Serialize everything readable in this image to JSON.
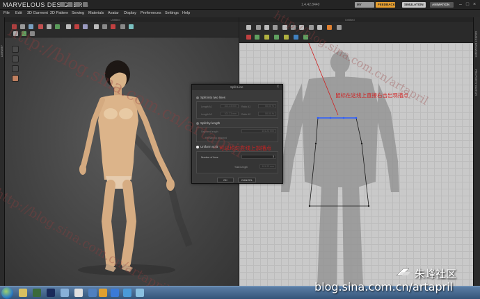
{
  "app": {
    "title": "MARVELOUS DESIGNER 4",
    "version": "1.4.42.8440",
    "buttons": {
      "account": "MY ACCOUNT",
      "feedback": "FEEDBACK",
      "simulation": "SIMULATION",
      "animation": "ANIMATION"
    },
    "window_controls": [
      "–",
      "□",
      "×"
    ]
  },
  "menu": [
    "File",
    "Edit",
    "3D Garment",
    "2D Pattern",
    "Sewing",
    "Materials",
    "Avatar",
    "Display",
    "Preferences",
    "Settings",
    "Help"
  ],
  "panels": {
    "left_strip_label": "LIBRARY",
    "view3d_title": "Untitled",
    "view2d_title": "Untitled",
    "right_strip_labels": [
      "OBJECT BROWSER",
      "PROPERTY EDITOR"
    ]
  },
  "dialog": {
    "title": "Split Line",
    "close": "x",
    "option_two_lines": "Split into two lines",
    "length1_label": "Length A1",
    "length1_value": "101.23 mm",
    "length2_label": "Length A2",
    "length2_value": "101.23 mm",
    "ratio1_label": "Ratio A1",
    "ratio1_value": "50.00 %",
    "ratio2_label": "Ratio A2",
    "ratio2_value": "50.00 %",
    "option_by_length": "Split by length",
    "segment_length_label": "Segment length",
    "segment_length_value": "101.23 mm",
    "remaining_label": "Remaining attached",
    "option_uniform": "Uniform split",
    "num_lines_label": "Number of lines",
    "num_lines_value": "3",
    "total_length_label": "Total Length",
    "total_length_value": "101.23 mm",
    "ok": "OK",
    "cancel": "CANCEL"
  },
  "annotations": {
    "right_click_note": "鼠标在这线上直接右击出现描点",
    "add_points_note": "可以均匀在线上加描点"
  },
  "watermarks": {
    "diagonal_url": "http://blog.sina.com.cn/artapril",
    "brand_name": "朱峰社区",
    "brand_blog": "blog.sina.com.cn/artapril"
  },
  "colors": {
    "accent_orange": "#e8a030",
    "annotation_red": "#d02020",
    "pattern_blue": "#2a5cff"
  }
}
